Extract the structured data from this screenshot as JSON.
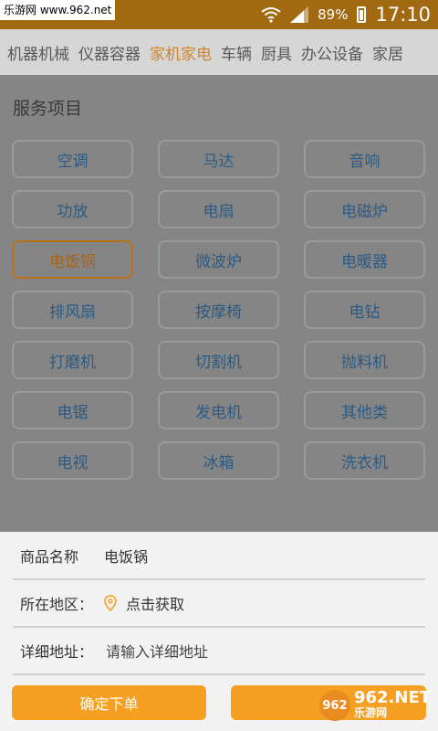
{
  "status_bar": {
    "watermark": "乐游网 www.962.net",
    "battery_percent": "89%",
    "time": "17:10",
    "icons": [
      "wifi-icon",
      "signal-icon",
      "battery-icon"
    ]
  },
  "categories": [
    "机器机械",
    "仪器容器",
    "家机家电",
    "车辆",
    "厨具",
    "办公设备",
    "家居"
  ],
  "active_category": "家机家电",
  "services": {
    "title": "服务项目",
    "items": [
      "空调",
      "马达",
      "音响",
      "功放",
      "电扇",
      "电磁炉",
      "电饭锅",
      "微波炉",
      "电暖器",
      "排风扇",
      "按摩椅",
      "电钻",
      "打磨机",
      "切割机",
      "抛料机",
      "电锯",
      "发电机",
      "其他类",
      "电视",
      "冰箱",
      "洗衣机"
    ],
    "selected": "电饭锅"
  },
  "order_form": {
    "product_label": "商品名称",
    "product_value": "电饭锅",
    "region_label": "所在地区：",
    "region_value": "点击获取",
    "address_label": "详细地址：",
    "address_placeholder": "请输入详细地址",
    "confirm_button": "确定下单"
  },
  "logo": {
    "badge": "962",
    "line1": "962.NET",
    "line2": "乐游网"
  },
  "colors": {
    "accent": "#f5a022",
    "status_bar": "#a26a10",
    "selected_border": "#b87314"
  }
}
